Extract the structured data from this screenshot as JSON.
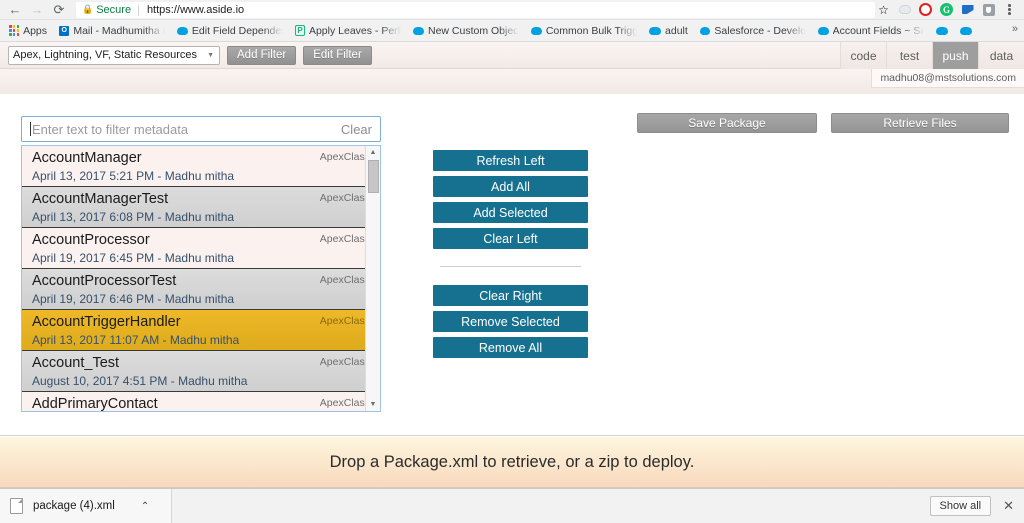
{
  "browser": {
    "back_icon": "back-arrow-icon",
    "forward_icon": "forward-arrow-icon",
    "reload_icon": "reload-icon",
    "security_label": "Secure",
    "url": "https://www.aside.io",
    "star_icon": "☆",
    "extensions": [
      {
        "name": "cloud-extension-icon"
      },
      {
        "name": "opera-extension-icon"
      },
      {
        "name": "grammarly-extension-icon",
        "glyph": "G"
      },
      {
        "name": "blue-extension-icon"
      },
      {
        "name": "shield-extension-icon"
      }
    ],
    "menu_icon": "kebab-menu-icon",
    "bookmarks": [
      {
        "label": "Apps",
        "icon": "apps-grid-icon"
      },
      {
        "label": "Mail - Madhumitha M",
        "icon": "outlook-icon"
      },
      {
        "label": "Edit Field Dependenc",
        "icon": "salesforce-cloud-icon"
      },
      {
        "label": "Apply Leaves - Perk C",
        "icon": "perk-icon"
      },
      {
        "label": "New Custom Object -",
        "icon": "salesforce-cloud-icon"
      },
      {
        "label": "Common Bulk Trigger",
        "icon": "salesforce-cloud-icon"
      },
      {
        "label": "adult",
        "icon": "salesforce-cloud-icon"
      },
      {
        "label": "Salesforce - Develope",
        "icon": "salesforce-cloud-icon"
      },
      {
        "label": "Account Fields ~ Sale",
        "icon": "salesforce-cloud-icon"
      },
      {
        "label": "",
        "icon": "salesforce-cloud-icon"
      },
      {
        "label": "",
        "icon": "salesforce-cloud-icon"
      }
    ],
    "bookmarks_overflow": "»"
  },
  "toolbar": {
    "filter_value": "Apex, Lightning, VF, Static Resources",
    "add_filter_label": "Add Filter",
    "edit_filter_label": "Edit Filter",
    "tabs": [
      {
        "label": "code",
        "active": false
      },
      {
        "label": "test",
        "active": false
      },
      {
        "label": "push",
        "active": true
      },
      {
        "label": "data",
        "active": false
      }
    ],
    "user": "madhu08@mstsolutions.com"
  },
  "filter": {
    "placeholder": "Enter text to filter metadata",
    "value": "",
    "clear_label": "Clear"
  },
  "metadata_list": {
    "items": [
      {
        "name": "AccountManager",
        "meta": "April 13, 2017 5:21 PM - Madhu mitha",
        "type": "ApexClass",
        "state": "odd"
      },
      {
        "name": "AccountManagerTest",
        "meta": "April 13, 2017 6:08 PM - Madhu mitha",
        "type": "ApexClass",
        "state": "even"
      },
      {
        "name": "AccountProcessor",
        "meta": "April 19, 2017 6:45 PM - Madhu mitha",
        "type": "ApexClass",
        "state": "odd"
      },
      {
        "name": "AccountProcessorTest",
        "meta": "April 19, 2017 6:46 PM - Madhu mitha",
        "type": "ApexClass",
        "state": "even"
      },
      {
        "name": "AccountTriggerHandler",
        "meta": "April 13, 2017 11:07 AM - Madhu mitha",
        "type": "ApexClass",
        "state": "sel"
      },
      {
        "name": "Account_Test",
        "meta": "August 10, 2017 4:51 PM - Madhu mitha",
        "type": "ApexClass",
        "state": "even"
      },
      {
        "name": "AddPrimaryContact",
        "meta": "",
        "type": "ApexClass",
        "state": "odd"
      }
    ],
    "scroll_up_icon": "▲",
    "scroll_down_icon": "▼"
  },
  "actions": {
    "group_left": [
      {
        "label": "Refresh Left"
      },
      {
        "label": "Add All"
      },
      {
        "label": "Add Selected"
      },
      {
        "label": "Clear Left"
      }
    ],
    "group_right": [
      {
        "label": "Clear Right"
      },
      {
        "label": "Remove Selected"
      },
      {
        "label": "Remove All"
      }
    ],
    "button_color": "#16708f"
  },
  "package_actions": {
    "save_label": "Save Package",
    "retrieve_label": "Retrieve Files"
  },
  "dropzone": {
    "message": "Drop a Package.xml to retrieve, or a zip to deploy.",
    "bg_from": "#fdf6de",
    "bg_to": "#f8d9bd"
  },
  "downloads": {
    "file_name": "package (4).xml",
    "file_icon": "document-icon",
    "caret_icon": "⌃",
    "show_all_label": "Show all",
    "close_icon": "✕"
  }
}
